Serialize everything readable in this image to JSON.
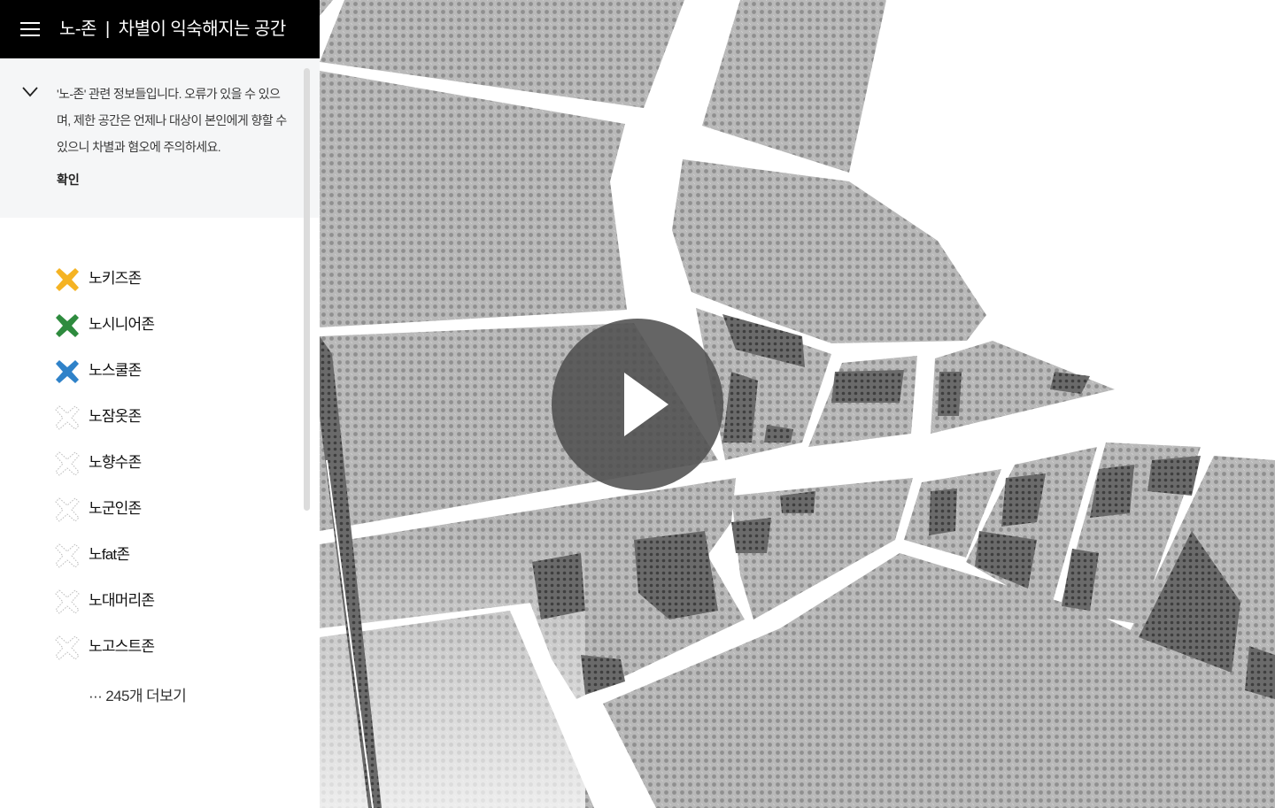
{
  "header": {
    "title_main": "노-존",
    "title_separator": "|",
    "title_sub": "차별이 익숙해지는 공간",
    "menu_icon": "hamburger-menu-icon"
  },
  "notice": {
    "text": "'노-존' 관련 정보들입니다. 오류가 있을 수 있으며, 제한 공간은 언제나 대상이 본인에게 향할 수 있으니 차별과 혐오에 주의하세요.",
    "confirm_label": "확인",
    "toggle_icon": "chevron-down-icon"
  },
  "zones": [
    {
      "label": "노키즈존",
      "color": "#f5b323",
      "active": true
    },
    {
      "label": "노시니어존",
      "color": "#2e8b3e",
      "active": true
    },
    {
      "label": "노스쿨존",
      "color": "#2f82c9",
      "active": true
    },
    {
      "label": "노잠옷존",
      "color": "#bdbdbd",
      "active": false
    },
    {
      "label": "노향수존",
      "color": "#bdbdbd",
      "active": false
    },
    {
      "label": "노군인존",
      "color": "#bdbdbd",
      "active": false
    },
    {
      "label": "노fat존",
      "color": "#bdbdbd",
      "active": false
    },
    {
      "label": "노대머리존",
      "color": "#bdbdbd",
      "active": false
    },
    {
      "label": "노고스트존",
      "color": "#bdbdbd",
      "active": false
    }
  ],
  "more_label": "··· 245개 더보기",
  "map": {
    "play_icon": "play-icon",
    "colors": {
      "block": "#a9a9a9",
      "building": "#5e5e5e",
      "road": "#ffffff"
    }
  }
}
